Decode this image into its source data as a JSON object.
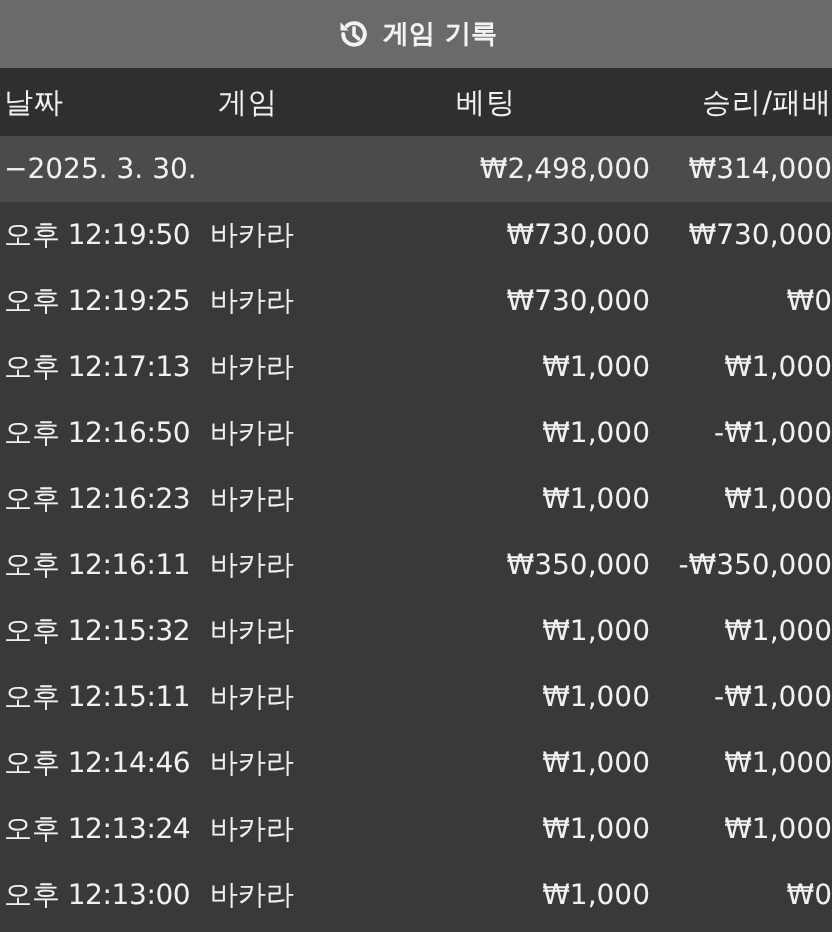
{
  "title": "게임 기록",
  "columns": [
    "날짜",
    "게임",
    "베팅",
    "승리/패배"
  ],
  "group": {
    "toggle": "−",
    "date": "2025. 3. 30.",
    "bet": "₩2,498,000",
    "result": "₩314,000"
  },
  "rows": [
    {
      "time": "오후 12:19:50",
      "game": "바카라",
      "bet": "₩730,000",
      "result": "₩730,000"
    },
    {
      "time": "오후 12:19:25",
      "game": "바카라",
      "bet": "₩730,000",
      "result": "₩0"
    },
    {
      "time": "오후 12:17:13",
      "game": "바카라",
      "bet": "₩1,000",
      "result": "₩1,000"
    },
    {
      "time": "오후 12:16:50",
      "game": "바카라",
      "bet": "₩1,000",
      "result": "-₩1,000"
    },
    {
      "time": "오후 12:16:23",
      "game": "바카라",
      "bet": "₩1,000",
      "result": "₩1,000"
    },
    {
      "time": "오후 12:16:11",
      "game": "바카라",
      "bet": "₩350,000",
      "result": "-₩350,000"
    },
    {
      "time": "오후 12:15:32",
      "game": "바카라",
      "bet": "₩1,000",
      "result": "₩1,000"
    },
    {
      "time": "오후 12:15:11",
      "game": "바카라",
      "bet": "₩1,000",
      "result": "-₩1,000"
    },
    {
      "time": "오후 12:14:46",
      "game": "바카라",
      "bet": "₩1,000",
      "result": "₩1,000"
    },
    {
      "time": "오후 12:13:24",
      "game": "바카라",
      "bet": "₩1,000",
      "result": "₩1,000"
    },
    {
      "time": "오후 12:13:00",
      "game": "바카라",
      "bet": "₩1,000",
      "result": "₩0"
    }
  ]
}
